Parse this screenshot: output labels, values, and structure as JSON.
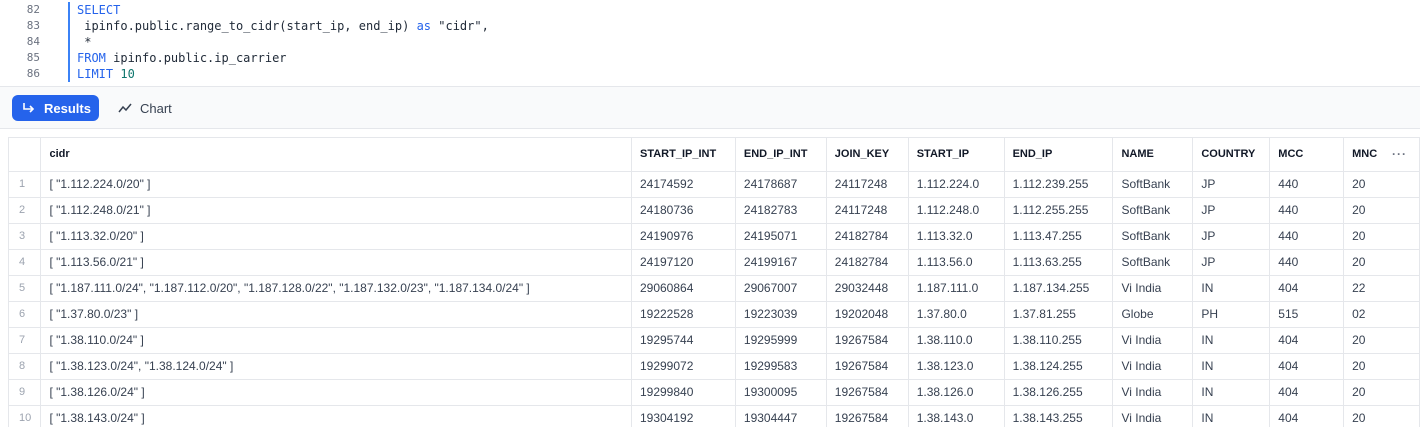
{
  "editor": {
    "lines": [
      {
        "num": "82",
        "parts": [
          {
            "t": "SELECT",
            "c": "kw"
          }
        ]
      },
      {
        "num": "83",
        "parts": [
          {
            "t": " ipinfo.public.range_to_cidr(start_ip, end_ip) ",
            "c": ""
          },
          {
            "t": "as",
            "c": "kw"
          },
          {
            "t": " \"cidr\",",
            "c": "str"
          }
        ]
      },
      {
        "num": "84",
        "parts": [
          {
            "t": " *",
            "c": ""
          }
        ]
      },
      {
        "num": "85",
        "parts": [
          {
            "t": "FROM",
            "c": "kw"
          },
          {
            "t": " ipinfo.public.ip_carrier",
            "c": ""
          }
        ]
      },
      {
        "num": "86",
        "parts": [
          {
            "t": "LIMIT",
            "c": "kw"
          },
          {
            "t": " ",
            "c": ""
          },
          {
            "t": "10",
            "c": "num"
          }
        ]
      }
    ]
  },
  "toolbar": {
    "results_label": "Results",
    "chart_label": "Chart",
    "results_icon": "return-arrow-icon",
    "chart_icon": "line-chart-icon"
  },
  "table": {
    "columns": [
      "cidr",
      "START_IP_INT",
      "END_IP_INT",
      "JOIN_KEY",
      "START_IP",
      "END_IP",
      "NAME",
      "COUNTRY",
      "MCC",
      "MNC"
    ],
    "rows": [
      [
        "1",
        "[  \"1.112.224.0/20\" ]",
        "24174592",
        "24178687",
        "24117248",
        "1.112.224.0",
        "1.112.239.255",
        "SoftBank",
        "JP",
        "440",
        "20"
      ],
      [
        "2",
        "[  \"1.112.248.0/21\" ]",
        "24180736",
        "24182783",
        "24117248",
        "1.112.248.0",
        "1.112.255.255",
        "SoftBank",
        "JP",
        "440",
        "20"
      ],
      [
        "3",
        "[  \"1.113.32.0/20\" ]",
        "24190976",
        "24195071",
        "24182784",
        "1.113.32.0",
        "1.113.47.255",
        "SoftBank",
        "JP",
        "440",
        "20"
      ],
      [
        "4",
        "[  \"1.113.56.0/21\" ]",
        "24197120",
        "24199167",
        "24182784",
        "1.113.56.0",
        "1.113.63.255",
        "SoftBank",
        "JP",
        "440",
        "20"
      ],
      [
        "5",
        "[  \"1.187.111.0/24\",   \"1.187.112.0/20\",   \"1.187.128.0/22\",   \"1.187.132.0/23\",   \"1.187.134.0/24\" ]",
        "29060864",
        "29067007",
        "29032448",
        "1.187.111.0",
        "1.187.134.255",
        "Vi India",
        "IN",
        "404",
        "22"
      ],
      [
        "6",
        "[  \"1.37.80.0/23\" ]",
        "19222528",
        "19223039",
        "19202048",
        "1.37.80.0",
        "1.37.81.255",
        "Globe",
        "PH",
        "515",
        "02"
      ],
      [
        "7",
        "[  \"1.38.110.0/24\" ]",
        "19295744",
        "19295999",
        "19267584",
        "1.38.110.0",
        "1.38.110.255",
        "Vi India",
        "IN",
        "404",
        "20"
      ],
      [
        "8",
        "[  \"1.38.123.0/24\",   \"1.38.124.0/24\" ]",
        "19299072",
        "19299583",
        "19267584",
        "1.38.123.0",
        "1.38.124.255",
        "Vi India",
        "IN",
        "404",
        "20"
      ],
      [
        "9",
        "[  \"1.38.126.0/24\" ]",
        "19299840",
        "19300095",
        "19267584",
        "1.38.126.0",
        "1.38.126.255",
        "Vi India",
        "IN",
        "404",
        "20"
      ],
      [
        "10",
        "[  \"1.38.143.0/24\" ]",
        "19304192",
        "19304447",
        "19267584",
        "1.38.143.0",
        "1.38.143.255",
        "Vi India",
        "IN",
        "404",
        "20"
      ]
    ]
  },
  "colors": {
    "accent": "#2563eb",
    "keyword": "#2563eb",
    "border": "#e5e7eb"
  }
}
